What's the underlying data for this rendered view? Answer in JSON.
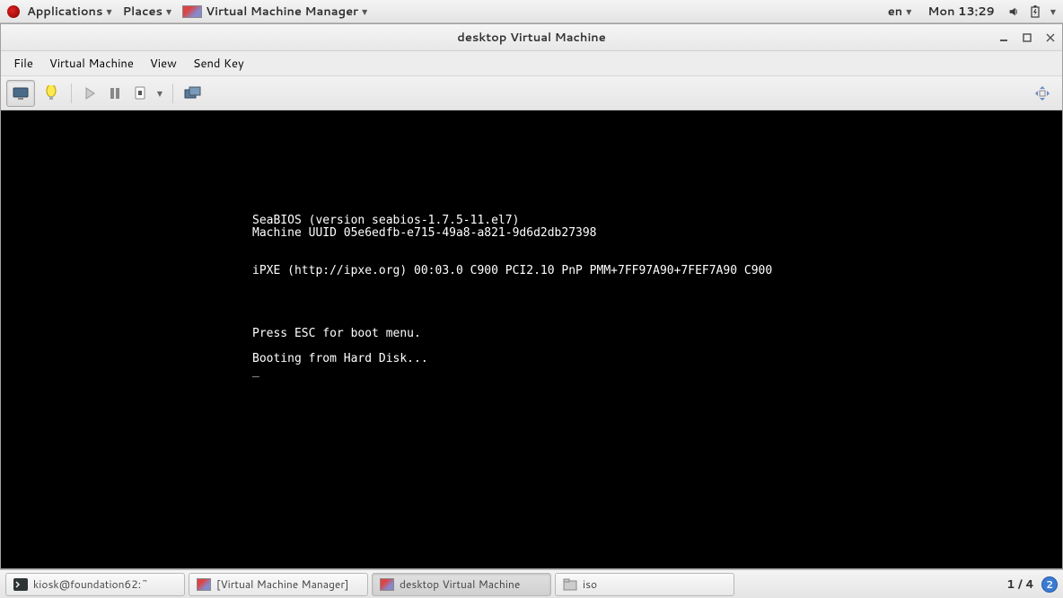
{
  "top_panel": {
    "applications": "Applications",
    "places": "Places",
    "app_menu": "Virtual Machine Manager",
    "lang": "en",
    "clock": "Mon 13:29"
  },
  "window": {
    "title": "desktop Virtual Machine"
  },
  "menubar": {
    "file": "File",
    "vm": "Virtual Machine",
    "view": "View",
    "sendkey": "Send Key"
  },
  "console": {
    "line1": "SeaBIOS (version seabios-1.7.5-11.el7)",
    "line2": "Machine UUID 05e6edfb-e715-49a8-a821-9d6d2db27398",
    "line3": "",
    "line4": "",
    "line5": "iPXE (http://ipxe.org) 00:03.0 C900 PCI2.10 PnP PMM+7FF97A90+7FEF7A90 C900",
    "line6": "",
    "line7": "",
    "line8": "",
    "line9": "",
    "line10": "Press ESC for boot menu.",
    "line11": "",
    "line12": "Booting from Hard Disk...",
    "line13": "_"
  },
  "taskbar": {
    "items": [
      {
        "label": "kiosk@foundation62:~"
      },
      {
        "label": "[Virtual Machine Manager]"
      },
      {
        "label": "desktop Virtual Machine"
      },
      {
        "label": "iso"
      }
    ],
    "workspace_label": "1 / 4",
    "workspace_badge": "2"
  }
}
